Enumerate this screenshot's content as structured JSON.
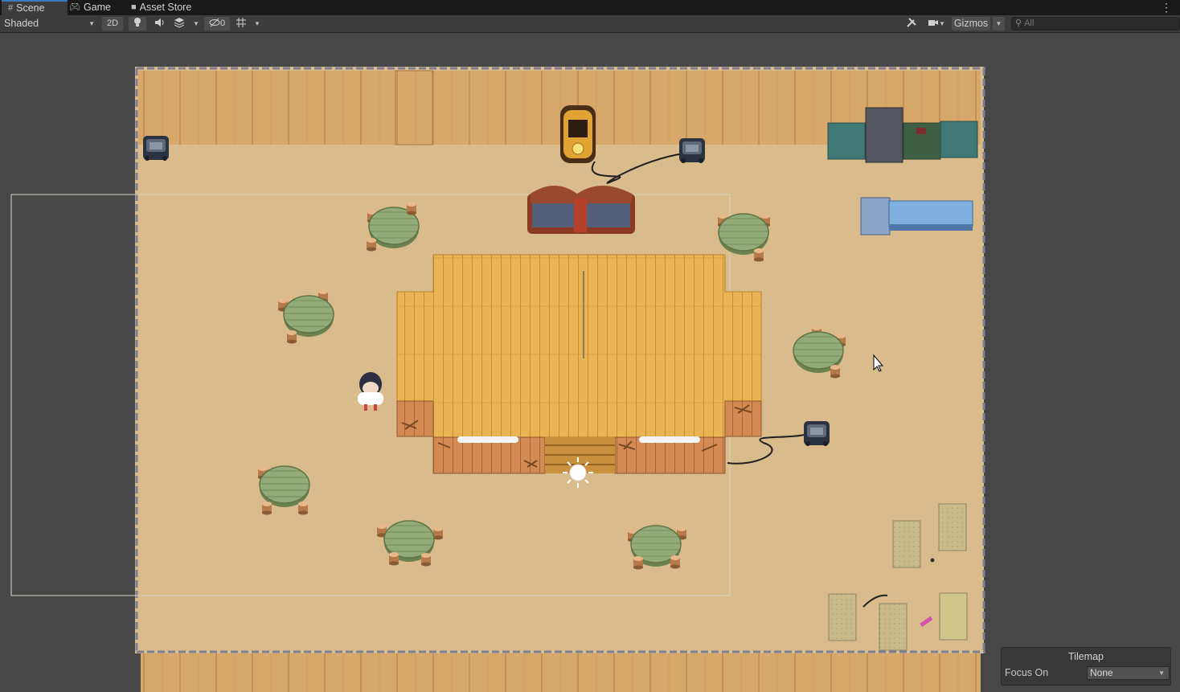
{
  "tabs": [
    {
      "label": "Scene",
      "icon": "hash-icon",
      "active": true
    },
    {
      "label": "Game",
      "icon": "gamepad-icon",
      "active": false
    },
    {
      "label": "Asset Store",
      "icon": "bag-icon",
      "active": false
    }
  ],
  "toolbar": {
    "shading_mode": "Shaded",
    "mode_2d_label": "2D",
    "hidden_count": "0",
    "gizmos_label": "Gizmos",
    "search_placeholder": "All"
  },
  "overlay": {
    "title": "Tilemap",
    "focus_label": "Focus On",
    "focus_value": "None"
  },
  "colors": {
    "tab_accent": "#3a79bb",
    "floor_sand": "#d9bb8c",
    "wall_wood": "#d7a86a",
    "stage_wood": "#e8b24e",
    "table_green": "#8fa676"
  }
}
